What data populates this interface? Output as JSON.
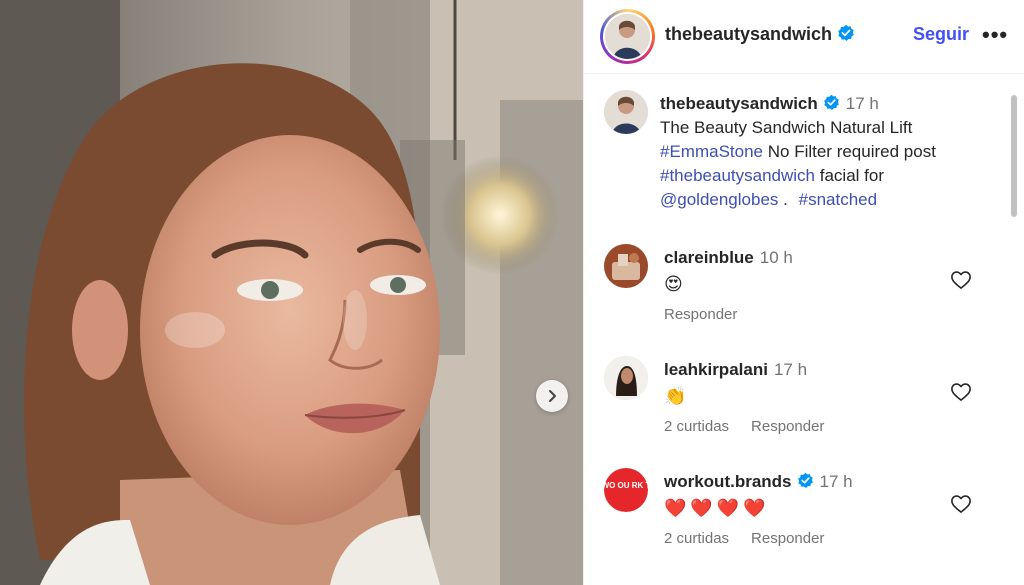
{
  "post": {
    "username": "thebeautysandwich",
    "follow_label": "Seguir",
    "more_label": "•••",
    "caption": {
      "username": "thebeautysandwich",
      "time": "17 h",
      "text": "The Beauty Sandwich Natural Lift",
      "tag1": "#EmmaStone",
      "text2": "No Filter required post",
      "tag2": "#thebeautysandwich",
      "text3": "facial for",
      "tag3": "@goldenglobes",
      "text4": ".",
      "tag4": "#snatched"
    }
  },
  "comments": [
    {
      "username": "clareinblue",
      "time": "10 h",
      "emoji": [
        "😍"
      ],
      "likes": "",
      "reply_label": "Responder"
    },
    {
      "username": "leahkirpalani",
      "time": "17 h",
      "emoji": [
        "👏"
      ],
      "likes": "2 curtidas",
      "reply_label": "Responder"
    },
    {
      "username": "workout.brands",
      "time": "17 h",
      "emoji": [
        "❤️",
        "❤️",
        "❤️",
        "❤️"
      ],
      "likes": "2 curtidas",
      "reply_label": "Responder",
      "avatar_text": "WO OU RK T"
    }
  ],
  "colors": {
    "link": "#3d4fb3",
    "follow": "#4150f7",
    "verified": "#0095f6",
    "muted": "#737373",
    "workout_brand": "#e5262b"
  },
  "icons": {
    "verified": "verified-badge-icon",
    "heart": "heart-outline-icon",
    "next": "chevron-right-icon"
  }
}
